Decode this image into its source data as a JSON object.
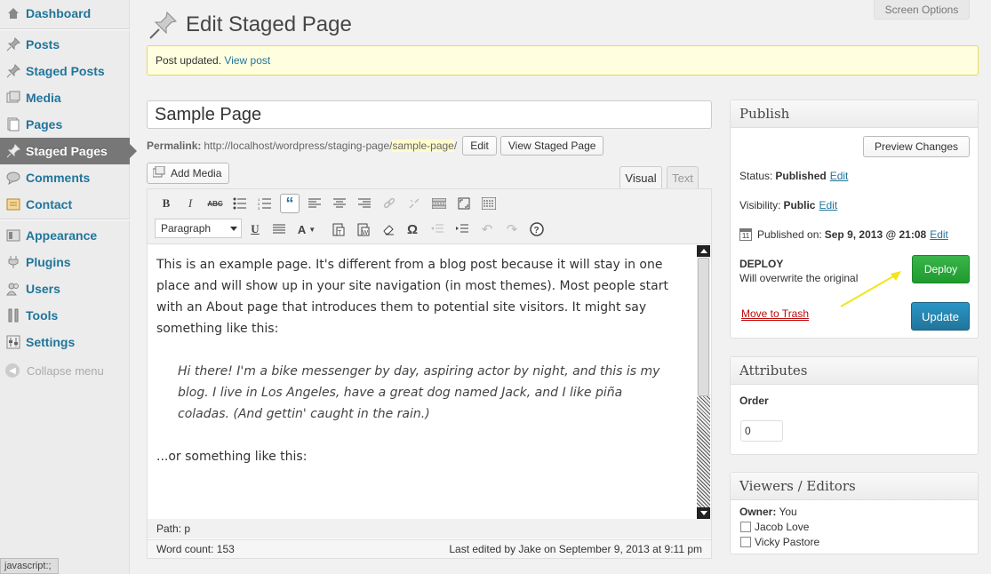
{
  "sidebar": {
    "items": [
      {
        "label": "Dashboard",
        "icon": "dashboard-icon"
      },
      {
        "label": "Posts",
        "icon": "pushpin-icon"
      },
      {
        "label": "Staged Posts",
        "icon": "pushpin-icon"
      },
      {
        "label": "Media",
        "icon": "media-icon"
      },
      {
        "label": "Pages",
        "icon": "pages-icon"
      },
      {
        "label": "Staged Pages",
        "icon": "pushpin-icon",
        "active": true
      },
      {
        "label": "Comments",
        "icon": "comment-icon"
      },
      {
        "label": "Contact",
        "icon": "contact-icon"
      },
      {
        "label": "Appearance",
        "icon": "appearance-icon"
      },
      {
        "label": "Plugins",
        "icon": "plugin-icon"
      },
      {
        "label": "Users",
        "icon": "users-icon"
      },
      {
        "label": "Tools",
        "icon": "tools-icon"
      },
      {
        "label": "Settings",
        "icon": "settings-icon"
      }
    ],
    "collapse_label": "Collapse menu"
  },
  "status_bar": "javascript:;",
  "screen_options": "Screen Options",
  "page_title": "Edit Staged Page",
  "notice": {
    "text": "Post updated.",
    "link": "View post"
  },
  "post_title": "Sample Page",
  "permalink": {
    "label": "Permalink:",
    "base": "http://localhost/wordpress/staging-page/",
    "slug": "sample-page",
    "trail": "/",
    "edit_button": "Edit",
    "view_button": "View Staged Page"
  },
  "add_media": "Add Media",
  "tabs": {
    "visual": "Visual",
    "text": "Text"
  },
  "toolbar": {
    "format_value": "Paragraph"
  },
  "content": {
    "p1": "This is an example page. It's different from a blog post because it will stay in one place and will show up in your site navigation (in most themes). Most people start with an About page that introduces them to potential site visitors. It might say something like this:",
    "quote": "Hi there! I'm a bike messenger by day, aspiring actor by night, and this is my blog. I live in Los Angeles, have a great dog named Jack, and I like piña coladas. (And gettin' caught in the rain.)",
    "p2": "...or something like this:"
  },
  "path": "Path: p",
  "word_count": "Word count: 153",
  "last_edited": "Last edited by Jake on September 9, 2013 at 9:11 pm",
  "publish": {
    "title": "Publish",
    "preview_button": "Preview Changes",
    "status_label": "Status:",
    "status_value": "Published",
    "visibility_label": "Visibility:",
    "visibility_value": "Public",
    "published_label": "Published on:",
    "published_value": "Sep 9, 2013 @ 21:08",
    "edit_link": "Edit",
    "deploy_label": "DEPLOY",
    "deploy_sub": "Will overwrite the original",
    "deploy_button": "Deploy",
    "trash_link": "Move to Trash",
    "update_button": "Update",
    "accent_green": "#2aa33a",
    "accent_blue": "#21759b",
    "arrow_color": "#f2e51b"
  },
  "attributes": {
    "title": "Attributes",
    "order_label": "Order",
    "order_value": "0"
  },
  "viewers": {
    "title": "Viewers / Editors",
    "owner_label": "Owner:",
    "owner_value": "You",
    "users": [
      "Jacob Love",
      "Vicky Pastore"
    ]
  }
}
